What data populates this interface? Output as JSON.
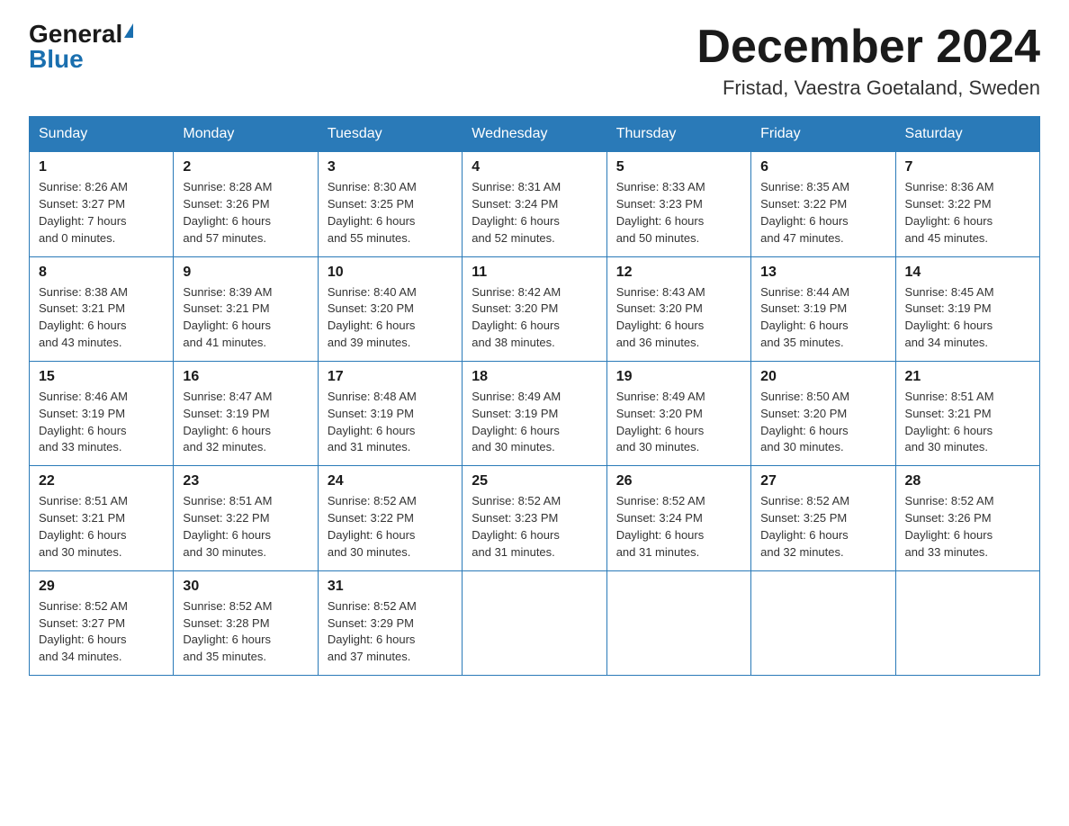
{
  "logo": {
    "general": "General",
    "blue": "Blue"
  },
  "header": {
    "month_title": "December 2024",
    "location": "Fristad, Vaestra Goetaland, Sweden"
  },
  "days_of_week": [
    "Sunday",
    "Monday",
    "Tuesday",
    "Wednesday",
    "Thursday",
    "Friday",
    "Saturday"
  ],
  "weeks": [
    [
      {
        "day": "1",
        "sunrise": "Sunrise: 8:26 AM",
        "sunset": "Sunset: 3:27 PM",
        "daylight": "Daylight: 7 hours",
        "daylight2": "and 0 minutes."
      },
      {
        "day": "2",
        "sunrise": "Sunrise: 8:28 AM",
        "sunset": "Sunset: 3:26 PM",
        "daylight": "Daylight: 6 hours",
        "daylight2": "and 57 minutes."
      },
      {
        "day": "3",
        "sunrise": "Sunrise: 8:30 AM",
        "sunset": "Sunset: 3:25 PM",
        "daylight": "Daylight: 6 hours",
        "daylight2": "and 55 minutes."
      },
      {
        "day": "4",
        "sunrise": "Sunrise: 8:31 AM",
        "sunset": "Sunset: 3:24 PM",
        "daylight": "Daylight: 6 hours",
        "daylight2": "and 52 minutes."
      },
      {
        "day": "5",
        "sunrise": "Sunrise: 8:33 AM",
        "sunset": "Sunset: 3:23 PM",
        "daylight": "Daylight: 6 hours",
        "daylight2": "and 50 minutes."
      },
      {
        "day": "6",
        "sunrise": "Sunrise: 8:35 AM",
        "sunset": "Sunset: 3:22 PM",
        "daylight": "Daylight: 6 hours",
        "daylight2": "and 47 minutes."
      },
      {
        "day": "7",
        "sunrise": "Sunrise: 8:36 AM",
        "sunset": "Sunset: 3:22 PM",
        "daylight": "Daylight: 6 hours",
        "daylight2": "and 45 minutes."
      }
    ],
    [
      {
        "day": "8",
        "sunrise": "Sunrise: 8:38 AM",
        "sunset": "Sunset: 3:21 PM",
        "daylight": "Daylight: 6 hours",
        "daylight2": "and 43 minutes."
      },
      {
        "day": "9",
        "sunrise": "Sunrise: 8:39 AM",
        "sunset": "Sunset: 3:21 PM",
        "daylight": "Daylight: 6 hours",
        "daylight2": "and 41 minutes."
      },
      {
        "day": "10",
        "sunrise": "Sunrise: 8:40 AM",
        "sunset": "Sunset: 3:20 PM",
        "daylight": "Daylight: 6 hours",
        "daylight2": "and 39 minutes."
      },
      {
        "day": "11",
        "sunrise": "Sunrise: 8:42 AM",
        "sunset": "Sunset: 3:20 PM",
        "daylight": "Daylight: 6 hours",
        "daylight2": "and 38 minutes."
      },
      {
        "day": "12",
        "sunrise": "Sunrise: 8:43 AM",
        "sunset": "Sunset: 3:20 PM",
        "daylight": "Daylight: 6 hours",
        "daylight2": "and 36 minutes."
      },
      {
        "day": "13",
        "sunrise": "Sunrise: 8:44 AM",
        "sunset": "Sunset: 3:19 PM",
        "daylight": "Daylight: 6 hours",
        "daylight2": "and 35 minutes."
      },
      {
        "day": "14",
        "sunrise": "Sunrise: 8:45 AM",
        "sunset": "Sunset: 3:19 PM",
        "daylight": "Daylight: 6 hours",
        "daylight2": "and 34 minutes."
      }
    ],
    [
      {
        "day": "15",
        "sunrise": "Sunrise: 8:46 AM",
        "sunset": "Sunset: 3:19 PM",
        "daylight": "Daylight: 6 hours",
        "daylight2": "and 33 minutes."
      },
      {
        "day": "16",
        "sunrise": "Sunrise: 8:47 AM",
        "sunset": "Sunset: 3:19 PM",
        "daylight": "Daylight: 6 hours",
        "daylight2": "and 32 minutes."
      },
      {
        "day": "17",
        "sunrise": "Sunrise: 8:48 AM",
        "sunset": "Sunset: 3:19 PM",
        "daylight": "Daylight: 6 hours",
        "daylight2": "and 31 minutes."
      },
      {
        "day": "18",
        "sunrise": "Sunrise: 8:49 AM",
        "sunset": "Sunset: 3:19 PM",
        "daylight": "Daylight: 6 hours",
        "daylight2": "and 30 minutes."
      },
      {
        "day": "19",
        "sunrise": "Sunrise: 8:49 AM",
        "sunset": "Sunset: 3:20 PM",
        "daylight": "Daylight: 6 hours",
        "daylight2": "and 30 minutes."
      },
      {
        "day": "20",
        "sunrise": "Sunrise: 8:50 AM",
        "sunset": "Sunset: 3:20 PM",
        "daylight": "Daylight: 6 hours",
        "daylight2": "and 30 minutes."
      },
      {
        "day": "21",
        "sunrise": "Sunrise: 8:51 AM",
        "sunset": "Sunset: 3:21 PM",
        "daylight": "Daylight: 6 hours",
        "daylight2": "and 30 minutes."
      }
    ],
    [
      {
        "day": "22",
        "sunrise": "Sunrise: 8:51 AM",
        "sunset": "Sunset: 3:21 PM",
        "daylight": "Daylight: 6 hours",
        "daylight2": "and 30 minutes."
      },
      {
        "day": "23",
        "sunrise": "Sunrise: 8:51 AM",
        "sunset": "Sunset: 3:22 PM",
        "daylight": "Daylight: 6 hours",
        "daylight2": "and 30 minutes."
      },
      {
        "day": "24",
        "sunrise": "Sunrise: 8:52 AM",
        "sunset": "Sunset: 3:22 PM",
        "daylight": "Daylight: 6 hours",
        "daylight2": "and 30 minutes."
      },
      {
        "day": "25",
        "sunrise": "Sunrise: 8:52 AM",
        "sunset": "Sunset: 3:23 PM",
        "daylight": "Daylight: 6 hours",
        "daylight2": "and 31 minutes."
      },
      {
        "day": "26",
        "sunrise": "Sunrise: 8:52 AM",
        "sunset": "Sunset: 3:24 PM",
        "daylight": "Daylight: 6 hours",
        "daylight2": "and 31 minutes."
      },
      {
        "day": "27",
        "sunrise": "Sunrise: 8:52 AM",
        "sunset": "Sunset: 3:25 PM",
        "daylight": "Daylight: 6 hours",
        "daylight2": "and 32 minutes."
      },
      {
        "day": "28",
        "sunrise": "Sunrise: 8:52 AM",
        "sunset": "Sunset: 3:26 PM",
        "daylight": "Daylight: 6 hours",
        "daylight2": "and 33 minutes."
      }
    ],
    [
      {
        "day": "29",
        "sunrise": "Sunrise: 8:52 AM",
        "sunset": "Sunset: 3:27 PM",
        "daylight": "Daylight: 6 hours",
        "daylight2": "and 34 minutes."
      },
      {
        "day": "30",
        "sunrise": "Sunrise: 8:52 AM",
        "sunset": "Sunset: 3:28 PM",
        "daylight": "Daylight: 6 hours",
        "daylight2": "and 35 minutes."
      },
      {
        "day": "31",
        "sunrise": "Sunrise: 8:52 AM",
        "sunset": "Sunset: 3:29 PM",
        "daylight": "Daylight: 6 hours",
        "daylight2": "and 37 minutes."
      },
      null,
      null,
      null,
      null
    ]
  ]
}
